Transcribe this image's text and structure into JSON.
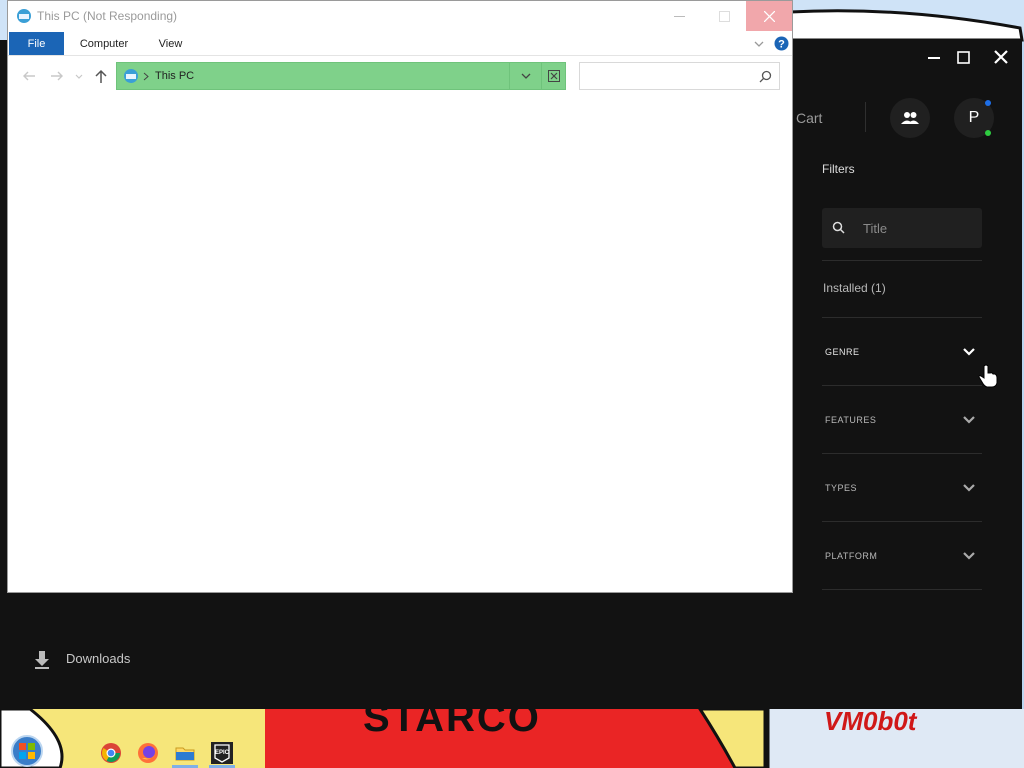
{
  "desktop": {
    "wallpaper_text": "STARCO",
    "watermark": "VM0b0t"
  },
  "epic": {
    "cart_label": "Cart",
    "avatar_initial": "P",
    "filters_label": "Filters",
    "search_placeholder": "Title",
    "installed_label": "Installed (1)",
    "categories": [
      "GENRE",
      "FEATURES",
      "TYPES",
      "PLATFORM"
    ],
    "downloads_label": "Downloads"
  },
  "explorer": {
    "title": "This PC (Not Responding)",
    "tabs": [
      "File",
      "Computer",
      "View"
    ],
    "address": "This PC",
    "search_value": ""
  },
  "taskbar": {
    "icons": [
      "start-orb-icon",
      "chrome-icon",
      "firefox-icon",
      "file-explorer-icon",
      "epic-games-icon"
    ]
  },
  "colors": {
    "explorer_file_tab": "#1b65b6",
    "address_highlight": "#7fd18a",
    "epic_bg": "#121212",
    "close_hover": "#e81123"
  }
}
